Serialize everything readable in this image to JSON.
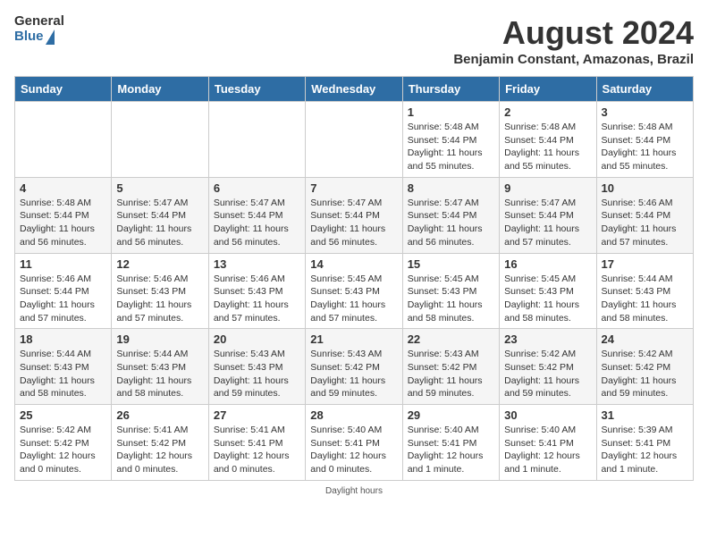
{
  "header": {
    "logo_general": "General",
    "logo_blue": "Blue",
    "month_title": "August 2024",
    "location": "Benjamin Constant, Amazonas, Brazil"
  },
  "days_of_week": [
    "Sunday",
    "Monday",
    "Tuesday",
    "Wednesday",
    "Thursday",
    "Friday",
    "Saturday"
  ],
  "weeks": [
    [
      {
        "day": "",
        "info": ""
      },
      {
        "day": "",
        "info": ""
      },
      {
        "day": "",
        "info": ""
      },
      {
        "day": "",
        "info": ""
      },
      {
        "day": "1",
        "info": "Sunrise: 5:48 AM\nSunset: 5:44 PM\nDaylight: 11 hours\nand 55 minutes."
      },
      {
        "day": "2",
        "info": "Sunrise: 5:48 AM\nSunset: 5:44 PM\nDaylight: 11 hours\nand 55 minutes."
      },
      {
        "day": "3",
        "info": "Sunrise: 5:48 AM\nSunset: 5:44 PM\nDaylight: 11 hours\nand 55 minutes."
      }
    ],
    [
      {
        "day": "4",
        "info": "Sunrise: 5:48 AM\nSunset: 5:44 PM\nDaylight: 11 hours\nand 56 minutes."
      },
      {
        "day": "5",
        "info": "Sunrise: 5:47 AM\nSunset: 5:44 PM\nDaylight: 11 hours\nand 56 minutes."
      },
      {
        "day": "6",
        "info": "Sunrise: 5:47 AM\nSunset: 5:44 PM\nDaylight: 11 hours\nand 56 minutes."
      },
      {
        "day": "7",
        "info": "Sunrise: 5:47 AM\nSunset: 5:44 PM\nDaylight: 11 hours\nand 56 minutes."
      },
      {
        "day": "8",
        "info": "Sunrise: 5:47 AM\nSunset: 5:44 PM\nDaylight: 11 hours\nand 56 minutes."
      },
      {
        "day": "9",
        "info": "Sunrise: 5:47 AM\nSunset: 5:44 PM\nDaylight: 11 hours\nand 57 minutes."
      },
      {
        "day": "10",
        "info": "Sunrise: 5:46 AM\nSunset: 5:44 PM\nDaylight: 11 hours\nand 57 minutes."
      }
    ],
    [
      {
        "day": "11",
        "info": "Sunrise: 5:46 AM\nSunset: 5:44 PM\nDaylight: 11 hours\nand 57 minutes."
      },
      {
        "day": "12",
        "info": "Sunrise: 5:46 AM\nSunset: 5:43 PM\nDaylight: 11 hours\nand 57 minutes."
      },
      {
        "day": "13",
        "info": "Sunrise: 5:46 AM\nSunset: 5:43 PM\nDaylight: 11 hours\nand 57 minutes."
      },
      {
        "day": "14",
        "info": "Sunrise: 5:45 AM\nSunset: 5:43 PM\nDaylight: 11 hours\nand 57 minutes."
      },
      {
        "day": "15",
        "info": "Sunrise: 5:45 AM\nSunset: 5:43 PM\nDaylight: 11 hours\nand 58 minutes."
      },
      {
        "day": "16",
        "info": "Sunrise: 5:45 AM\nSunset: 5:43 PM\nDaylight: 11 hours\nand 58 minutes."
      },
      {
        "day": "17",
        "info": "Sunrise: 5:44 AM\nSunset: 5:43 PM\nDaylight: 11 hours\nand 58 minutes."
      }
    ],
    [
      {
        "day": "18",
        "info": "Sunrise: 5:44 AM\nSunset: 5:43 PM\nDaylight: 11 hours\nand 58 minutes."
      },
      {
        "day": "19",
        "info": "Sunrise: 5:44 AM\nSunset: 5:43 PM\nDaylight: 11 hours\nand 58 minutes."
      },
      {
        "day": "20",
        "info": "Sunrise: 5:43 AM\nSunset: 5:43 PM\nDaylight: 11 hours\nand 59 minutes."
      },
      {
        "day": "21",
        "info": "Sunrise: 5:43 AM\nSunset: 5:42 PM\nDaylight: 11 hours\nand 59 minutes."
      },
      {
        "day": "22",
        "info": "Sunrise: 5:43 AM\nSunset: 5:42 PM\nDaylight: 11 hours\nand 59 minutes."
      },
      {
        "day": "23",
        "info": "Sunrise: 5:42 AM\nSunset: 5:42 PM\nDaylight: 11 hours\nand 59 minutes."
      },
      {
        "day": "24",
        "info": "Sunrise: 5:42 AM\nSunset: 5:42 PM\nDaylight: 11 hours\nand 59 minutes."
      }
    ],
    [
      {
        "day": "25",
        "info": "Sunrise: 5:42 AM\nSunset: 5:42 PM\nDaylight: 12 hours\nand 0 minutes."
      },
      {
        "day": "26",
        "info": "Sunrise: 5:41 AM\nSunset: 5:42 PM\nDaylight: 12 hours\nand 0 minutes."
      },
      {
        "day": "27",
        "info": "Sunrise: 5:41 AM\nSunset: 5:41 PM\nDaylight: 12 hours\nand 0 minutes."
      },
      {
        "day": "28",
        "info": "Sunrise: 5:40 AM\nSunset: 5:41 PM\nDaylight: 12 hours\nand 0 minutes."
      },
      {
        "day": "29",
        "info": "Sunrise: 5:40 AM\nSunset: 5:41 PM\nDaylight: 12 hours\nand 1 minute."
      },
      {
        "day": "30",
        "info": "Sunrise: 5:40 AM\nSunset: 5:41 PM\nDaylight: 12 hours\nand 1 minute."
      },
      {
        "day": "31",
        "info": "Sunrise: 5:39 AM\nSunset: 5:41 PM\nDaylight: 12 hours\nand 1 minute."
      }
    ]
  ],
  "daylight_note": "Daylight hours"
}
